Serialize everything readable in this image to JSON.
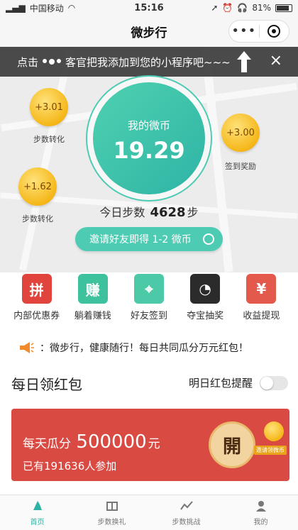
{
  "status_bar": {
    "carrier": "中国移动",
    "time": "15:16",
    "battery": "81%"
  },
  "title_bar": {
    "title": "微步行",
    "more": "•••"
  },
  "tip_banner": {
    "prefix": "点击",
    "text": "客官把我添加到您的小程序吧~~~",
    "close": "×"
  },
  "coin": {
    "label": "我的微币",
    "value": "19.29"
  },
  "gold_coins": [
    {
      "value": "+3.01",
      "label": "步数转化"
    },
    {
      "value": "+3.00",
      "label": "签到奖励"
    },
    {
      "value": "+1.62",
      "label": "步数转化"
    }
  ],
  "steps": {
    "prefix": "今日步数",
    "count": "4628",
    "unit": "步"
  },
  "invite": {
    "label": "邀请好友即得 1-2 微币"
  },
  "features": [
    {
      "label": "内部优惠券",
      "icon": "gift-icon",
      "color": "#e0443c",
      "glyph": "拼"
    },
    {
      "label": "躺着赚钱",
      "icon": "earn-icon",
      "color": "#3ec29e",
      "glyph": "赚"
    },
    {
      "label": "好友签到",
      "icon": "location-icon",
      "color": "#4ccaa8",
      "glyph": "⌖"
    },
    {
      "label": "夺宝抽奖",
      "icon": "gauge-icon",
      "color": "#2b2b2b",
      "glyph": "◔"
    },
    {
      "label": "收益提现",
      "icon": "yuan-icon",
      "color": "#e35a4c",
      "glyph": "¥"
    }
  ],
  "notice": {
    "text": "：微步行，健康随行！每日共同瓜分万元红包！"
  },
  "daily_redpacket": {
    "section_title": "每日领红包",
    "reminder_label": "明日红包提醒",
    "share_prefix": "每天瓜分",
    "amount": "500000",
    "unit": "元",
    "participants": "已有191636人参加",
    "open_label": "開",
    "coin_tag": "邀请领微币"
  },
  "tabs": [
    {
      "label": "首页",
      "icon": "home-icon",
      "active": true
    },
    {
      "label": "步数换礼",
      "icon": "gift-exchange-icon",
      "active": false
    },
    {
      "label": "步数挑战",
      "icon": "challenge-icon",
      "active": false
    },
    {
      "label": "我的",
      "icon": "profile-icon",
      "active": false
    }
  ],
  "colors": {
    "accent": "#4ecbb3",
    "redpacket": "#d94a43",
    "gold": "#f5b719"
  }
}
